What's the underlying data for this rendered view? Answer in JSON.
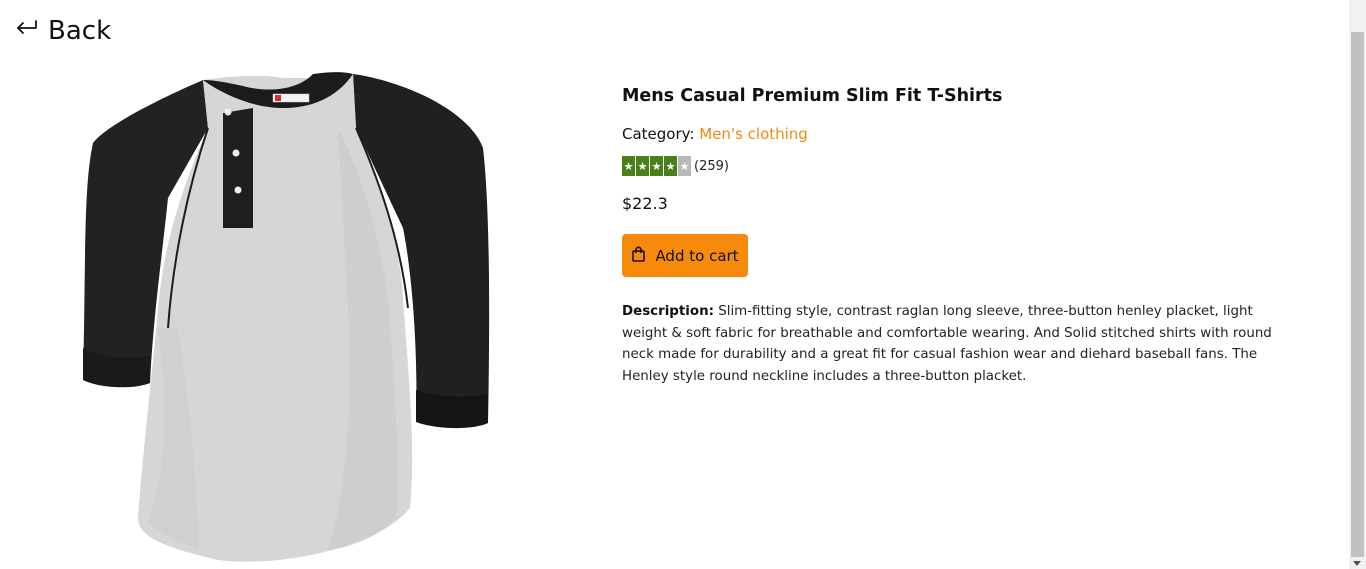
{
  "nav": {
    "back_label": "Back",
    "back_icon": "return-arrow-icon"
  },
  "product": {
    "title": "Mens Casual Premium Slim Fit T-Shirts",
    "category_label": "Category:",
    "category_value": "Men's clothing",
    "rating": {
      "stars": 4,
      "max_stars": 5,
      "count": "(259)"
    },
    "price": "$22.3",
    "image_alt": "Mens Casual Premium Slim Fit T-Shirts"
  },
  "cart": {
    "label": "Add to cart",
    "icon": "shopping-bag-icon"
  },
  "description": {
    "label": "Description:",
    "text": "Slim-fitting style, contrast raglan long sleeve, three-button henley placket, light weight & soft fabric for breathable and comfortable wearing. And Solid stitched shirts with round neck made for durability and a great fit for casual fashion wear and diehard baseball fans. The Henley style round neckline includes a three-button placket."
  },
  "colors": {
    "accent": "#f78a0b",
    "category_link": "#f08a0e",
    "star_on": "#4c7f1b",
    "star_off": "#b9b9b9"
  }
}
